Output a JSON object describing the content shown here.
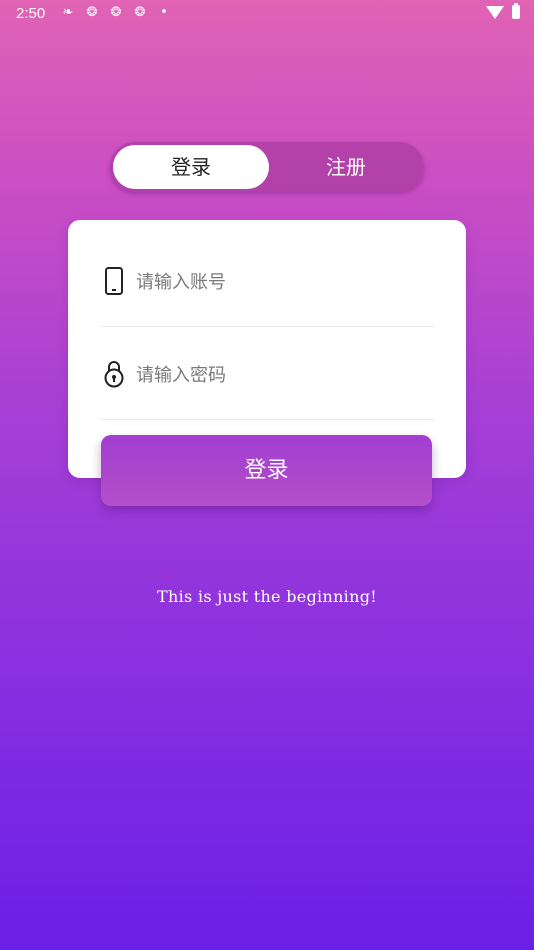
{
  "status_bar": {
    "time": "2:50",
    "icons": [
      "app-notification-icon",
      "sync-icon",
      "sync-icon",
      "sync-icon",
      "dot-icon"
    ],
    "right_icons": [
      "wifi-icon",
      "battery-icon"
    ]
  },
  "tabs": {
    "login": "登录",
    "register": "注册",
    "active": "login"
  },
  "form": {
    "account_placeholder": "请输入账号",
    "password_placeholder": "请输入密码",
    "submit_label": "登录"
  },
  "tagline": "This is just the beginning!",
  "colors": {
    "gradient_top": "#e063b4",
    "gradient_bottom": "#6a1fe6",
    "button": "#a13ed0",
    "toggle_bg": "#aa3ca0"
  }
}
